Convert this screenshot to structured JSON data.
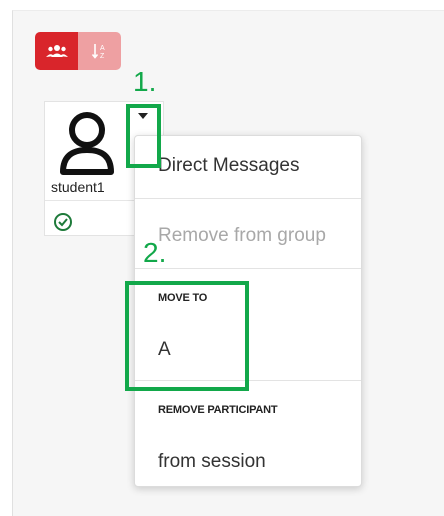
{
  "toolbar": {
    "group_view_icon": "group-icon",
    "sort_icon": "sort-alpha-icon"
  },
  "participant": {
    "name": "student1",
    "status_icon": "check-circle-icon",
    "avatar_icon": "user-avatar-icon",
    "menu_caret_icon": "caret-down-icon"
  },
  "menu": {
    "direct_messages": "Direct Messages",
    "remove_from_group": "Remove from group",
    "move_to_header": "MOVE TO",
    "move_to_option": "A",
    "remove_participant_header": "REMOVE PARTICIPANT",
    "from_session": "from session"
  },
  "annotations": {
    "step1": "1.",
    "step2": "2."
  },
  "colors": {
    "accent_red": "#d9252b",
    "annotation_green": "#12a84a"
  }
}
